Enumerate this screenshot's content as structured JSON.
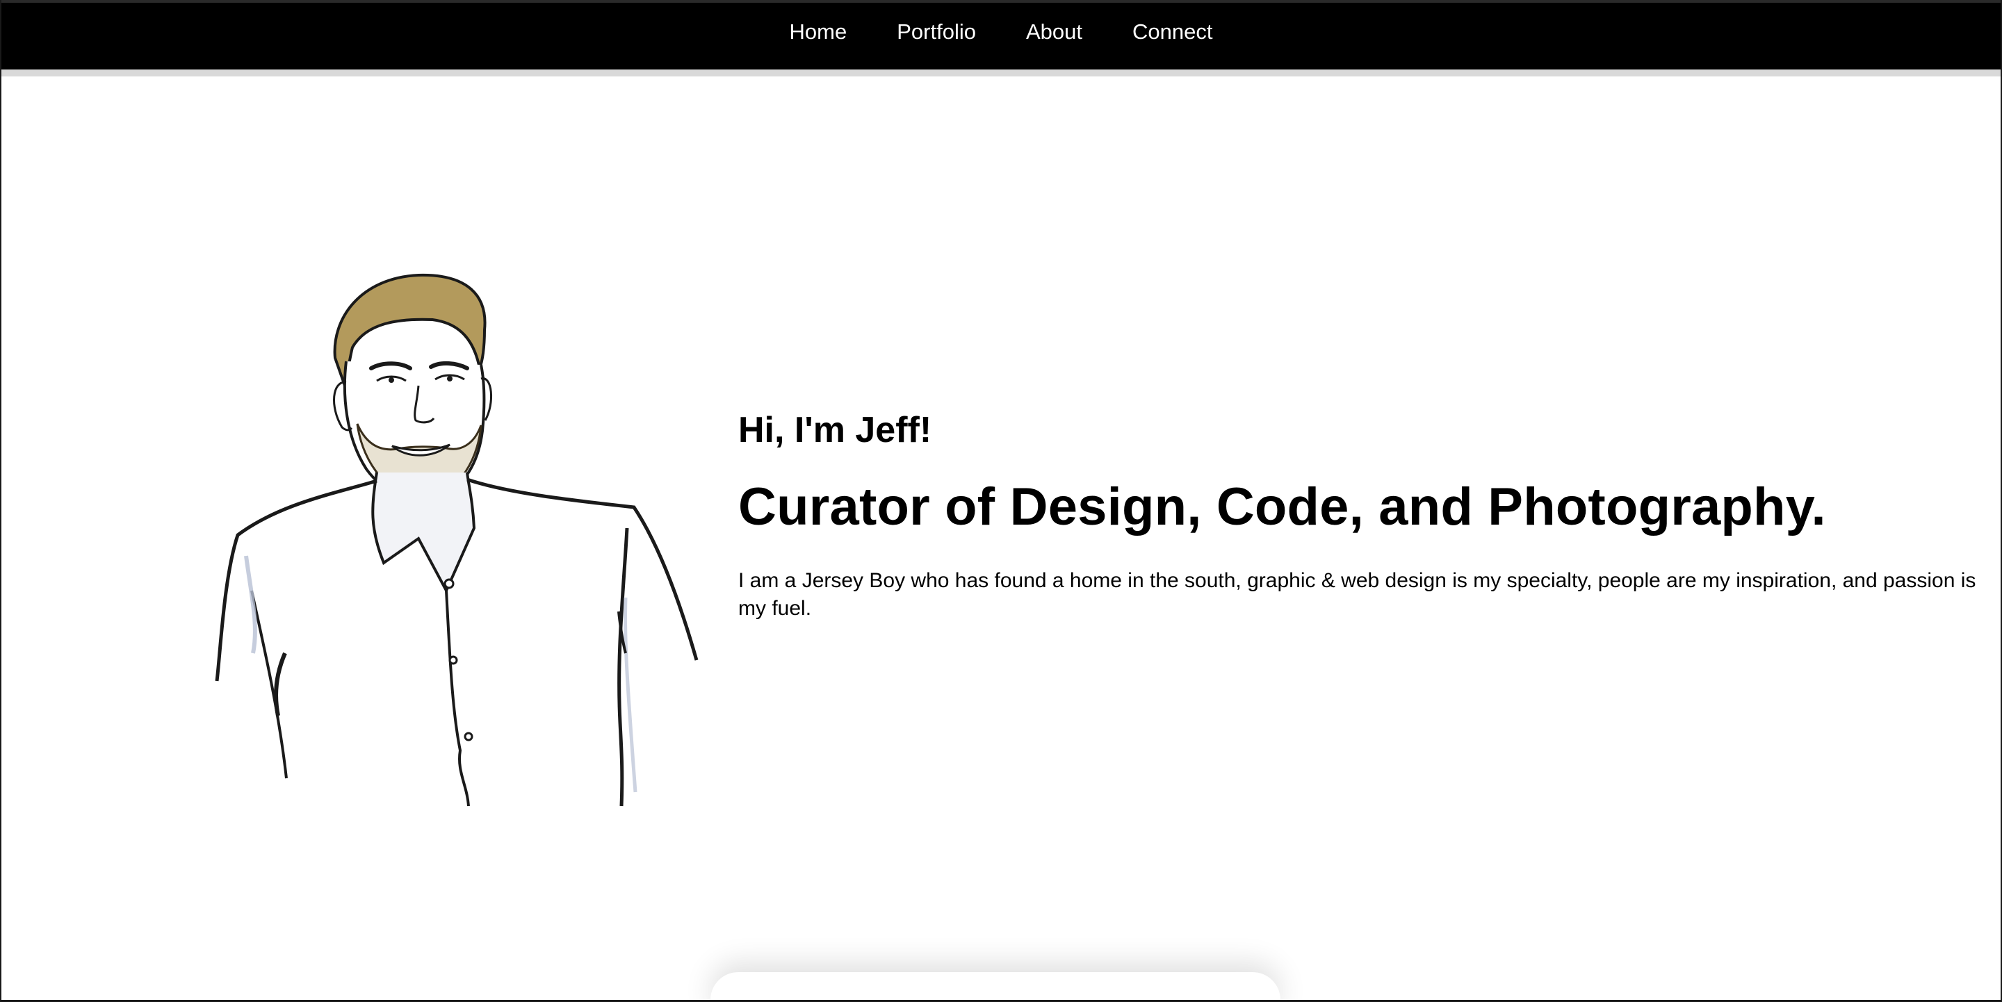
{
  "nav": {
    "items": [
      {
        "label": "Home"
      },
      {
        "label": "Portfolio"
      },
      {
        "label": "About"
      },
      {
        "label": "Connect"
      }
    ]
  },
  "hero": {
    "greeting": "Hi, I'm Jeff!",
    "headline": "Curator of Design, Code, and Photography.",
    "bio": "I am a Jersey Boy who has found a home in the south, graphic & web design is my specialty, people are my inspiration, and passion is my fuel."
  },
  "colors": {
    "nav_background": "#000000",
    "nav_text": "#ffffff",
    "page_background": "#ffffff",
    "hair": "#b39a5c"
  }
}
